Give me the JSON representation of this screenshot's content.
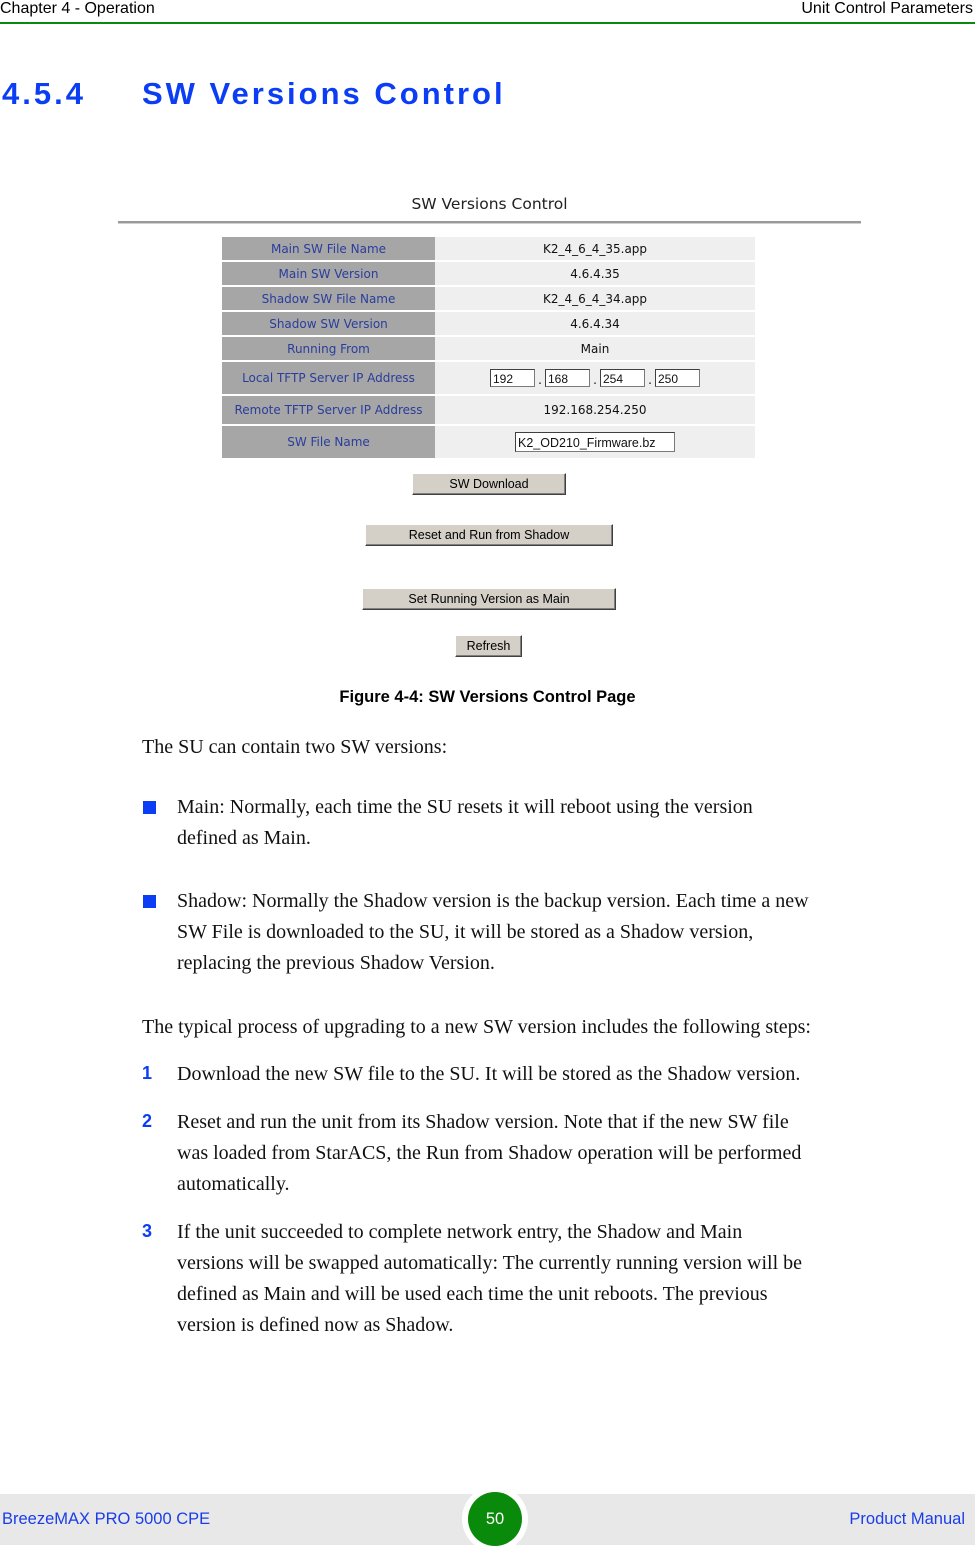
{
  "header": {
    "chapter": "Chapter 4 - Operation",
    "section": "Unit Control Parameters",
    "rule_color": "#0a8a0a"
  },
  "section": {
    "number": "4.5.4",
    "title": "SW Versions Control",
    "color": "#0b3df5"
  },
  "figure": {
    "panel_title": "SW Versions Control",
    "rows": [
      {
        "label": "Main SW File Name",
        "value": "K2_4_6_4_35.app"
      },
      {
        "label": "Main SW Version",
        "value": "4.6.4.35"
      },
      {
        "label": "Shadow SW File Name",
        "value": "K2_4_6_4_34.app"
      },
      {
        "label": "Shadow SW Version",
        "value": "4.6.4.34"
      },
      {
        "label": "Running From",
        "value": "Main"
      },
      {
        "label": "Local TFTP Server IP Address",
        "ip_octets": [
          "192",
          "168",
          "254",
          "250"
        ]
      },
      {
        "label": "Remote TFTP Server IP Address",
        "value": "192.168.254.250"
      },
      {
        "label": "SW File Name",
        "input_value": "K2_OD210_Firmware.bz"
      }
    ],
    "buttons": {
      "sw_download": "SW Download",
      "reset_run_shadow": "Reset and Run from Shadow",
      "set_running_main": "Set Running Version as Main",
      "refresh": "Refresh"
    },
    "caption": "Figure 4-4: SW Versions Control Page"
  },
  "body": {
    "intro": "The SU can contain two SW versions:",
    "bullets": [
      {
        "lines": [
          "Main: Normally, each time the SU resets it will reboot using the version",
          "defined as Main."
        ]
      },
      {
        "lines": [
          "Shadow: Normally the Shadow version is the backup version. Each time a new",
          "SW File is downloaded to the SU, it will be stored as a Shadow version,",
          "replacing the previous Shadow Version."
        ]
      }
    ],
    "steps_intro": "The typical process of upgrading to a new SW version includes the following steps:",
    "steps": [
      {
        "num": "1",
        "lines": [
          "Download the new SW file to the SU. It will be stored as the Shadow version."
        ]
      },
      {
        "num": "2",
        "lines": [
          "Reset and run the unit from its Shadow version. Note that if the new SW file",
          "was loaded from StarACS, the Run from Shadow operation will be performed",
          "automatically."
        ]
      },
      {
        "num": "3",
        "lines": [
          "If the unit succeeded to complete network entry, the Shadow and Main",
          "versions will be swapped automatically: The currently running version will be",
          "defined as Main and will be used each time the unit reboots. The previous",
          "version is defined now as Shadow."
        ]
      }
    ]
  },
  "footer": {
    "product": "BreezeMAX PRO 5000 CPE",
    "page_number": "50",
    "doc_type": "Product Manual"
  }
}
